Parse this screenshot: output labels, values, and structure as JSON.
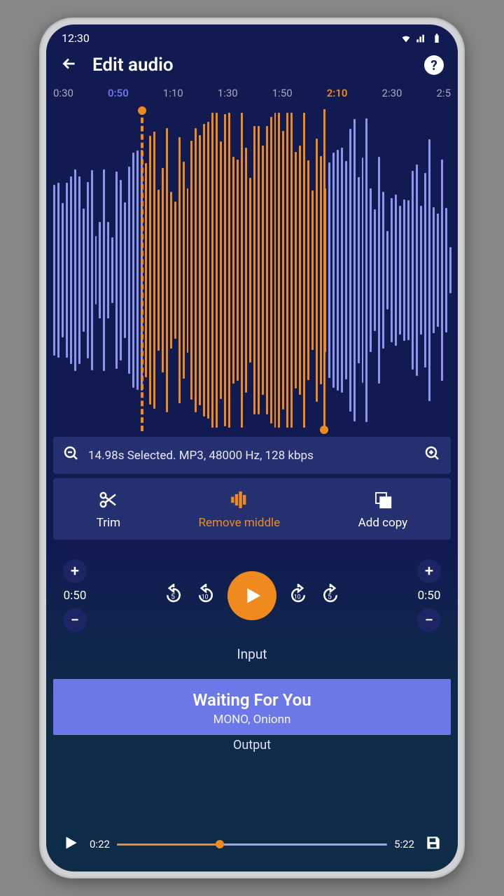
{
  "status": {
    "time": "12:30"
  },
  "header": {
    "title": "Edit audio"
  },
  "ticks": [
    "0:30",
    "0:50",
    "1:10",
    "1:30",
    "1:50",
    "2:10",
    "2:30",
    "2:5"
  ],
  "tick_highlight_blue": 1,
  "tick_highlight_orange": 5,
  "info": {
    "text": "14.98s Selected. MP3, 48000 Hz, 128 kbps"
  },
  "actions": {
    "trim": "Trim",
    "remove_middle": "Remove middle",
    "add_copy": "Add copy"
  },
  "player": {
    "left_time": "0:50",
    "right_time": "0:50",
    "input_label": "Input"
  },
  "now_playing": {
    "title": "Waiting For You",
    "artist": "MONO, Onionn"
  },
  "output": {
    "label": "Output",
    "current": "0:22",
    "duration": "5:22",
    "progress_pct": 38
  }
}
